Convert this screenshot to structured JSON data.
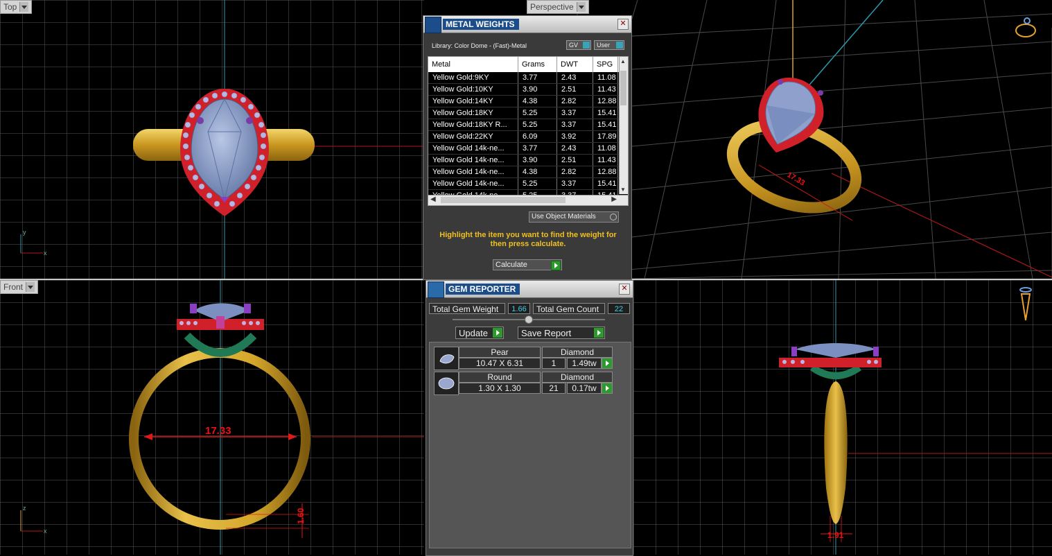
{
  "viewports": {
    "top": {
      "label": "Top",
      "axis_y": "y",
      "axis_x": "x"
    },
    "perspective": {
      "label": "Perspective",
      "dim_label": "17.33"
    },
    "front": {
      "label": "Front",
      "dim_width": "17.33",
      "dim_height": "1.60",
      "axis_z": "z",
      "axis_x": "x"
    },
    "right": {
      "dim_bottom": "1.91"
    }
  },
  "metal_weights": {
    "title": "METAL WEIGHTS",
    "library": "Library: Color Dome - (Fast)-Metal",
    "toggle_gv": "GV",
    "toggle_user": "User",
    "columns": [
      "Metal",
      "Grams",
      "DWT",
      "SPG"
    ],
    "rows": [
      [
        "Yellow Gold:9KY",
        "3.77",
        "2.43",
        "11.08"
      ],
      [
        "Yellow Gold:10KY",
        "3.90",
        "2.51",
        "11.43"
      ],
      [
        "Yellow Gold:14KY",
        "4.38",
        "2.82",
        "12.88"
      ],
      [
        "Yellow Gold:18KY",
        "5.25",
        "3.37",
        "15.41"
      ],
      [
        "Yellow Gold:18KY R...",
        "5.25",
        "3.37",
        "15.41"
      ],
      [
        "Yellow Gold:22KY",
        "6.09",
        "3.92",
        "17.89"
      ],
      [
        "Yellow Gold 14k-ne...",
        "3.77",
        "2.43",
        "11.08"
      ],
      [
        "Yellow Gold 14k-ne...",
        "3.90",
        "2.51",
        "11.43"
      ],
      [
        "Yellow Gold 14k-ne...",
        "4.38",
        "2.82",
        "12.88"
      ],
      [
        "Yellow Gold 14k-ne...",
        "5.25",
        "3.37",
        "15.41"
      ],
      [
        "Yellow Gold 14k-ne...",
        "5.25",
        "3.37",
        "15.41"
      ]
    ],
    "use_object_materials": "Use Object Materials",
    "instruction": "Highlight the item you want to find the weight for then press calculate.",
    "calculate": "Calculate"
  },
  "gem_reporter": {
    "title": "GEM REPORTER",
    "total_weight_label": "Total Gem Weight",
    "total_weight_value": "1.66",
    "total_count_label": "Total Gem Count",
    "total_count_value": "22",
    "update": "Update",
    "save_report": "Save Report",
    "gems": [
      {
        "shape": "Pear",
        "material": "Diamond",
        "size": "10.47 X 6.31",
        "count": "1",
        "weight": "1.49tw"
      },
      {
        "shape": "Round",
        "material": "Diamond",
        "size": "1.30 X 1.30",
        "count": "21",
        "weight": "0.17tw"
      }
    ]
  },
  "colors": {
    "gold": "#d6a72c",
    "halo": "#d0202a",
    "stone": "#7b90c0",
    "purple": "#8a3fc0",
    "green": "#1f7a55"
  }
}
